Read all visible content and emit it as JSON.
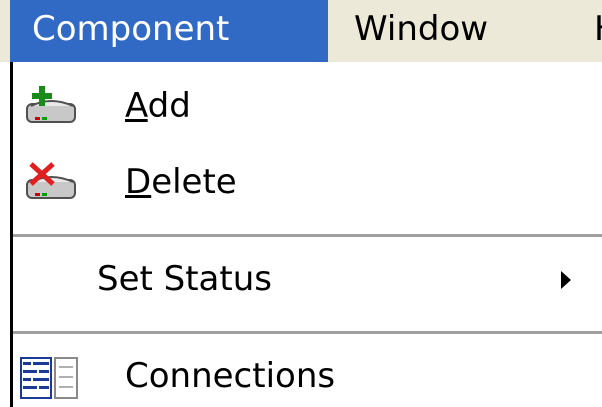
{
  "menubar": {
    "items": [
      {
        "label": "Component",
        "selected": true
      },
      {
        "label": "Window",
        "selected": false
      },
      {
        "label": "H",
        "selected": false
      }
    ]
  },
  "menu": {
    "add": {
      "mnemonic": "A",
      "rest": "dd",
      "icon": "disk-add-icon"
    },
    "delete": {
      "mnemonic": "D",
      "rest": "elete",
      "icon": "disk-delete-icon"
    },
    "set_status": {
      "label": "Set Status",
      "submenu_icon": "submenu-arrow-icon"
    },
    "connections": {
      "label": "Connections",
      "icon": "connections-icon"
    }
  },
  "colors": {
    "selection": "#316ac5",
    "menubar_bg": "#ece9d8",
    "menu_bg": "#ffffff",
    "add_plus": "#1a8a1a",
    "delete_x": "#e02020"
  }
}
